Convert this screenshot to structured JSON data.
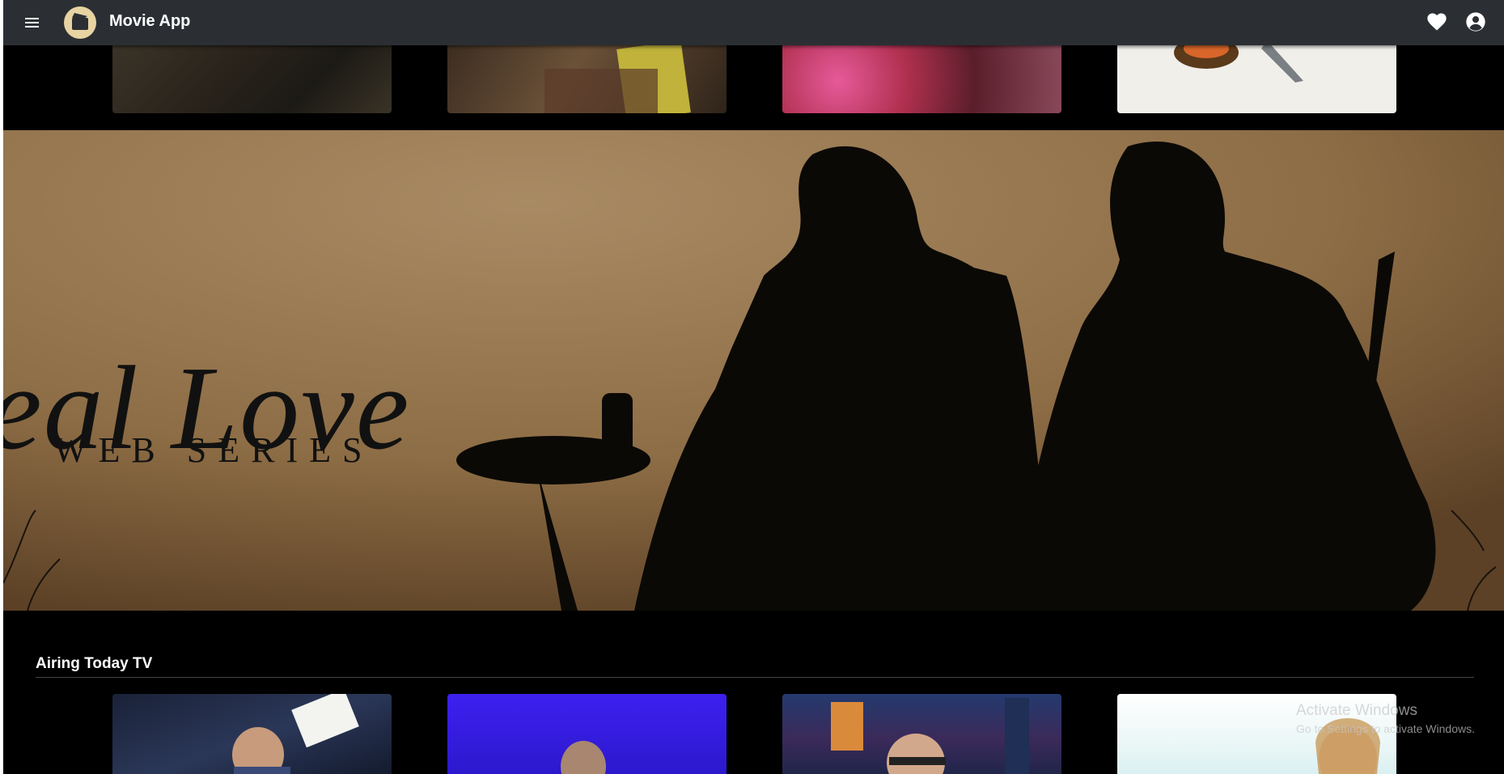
{
  "app": {
    "title": "Movie App"
  },
  "header": {
    "menu_icon": "menu-icon",
    "logo_icon": "clapperboard-icon",
    "favorites_icon": "heart-icon",
    "account_icon": "account-circle-icon"
  },
  "hero": {
    "title": "eal Love",
    "subtitle": "WEB SERIES"
  },
  "sections": [
    {
      "title": "Airing Today TV"
    }
  ],
  "watermark": {
    "line1": "Activate Windows",
    "line2": "Go to Settings to activate Windows."
  },
  "colors": {
    "appbar": "#2b2f33",
    "background": "#000000",
    "text": "#ffffff"
  }
}
